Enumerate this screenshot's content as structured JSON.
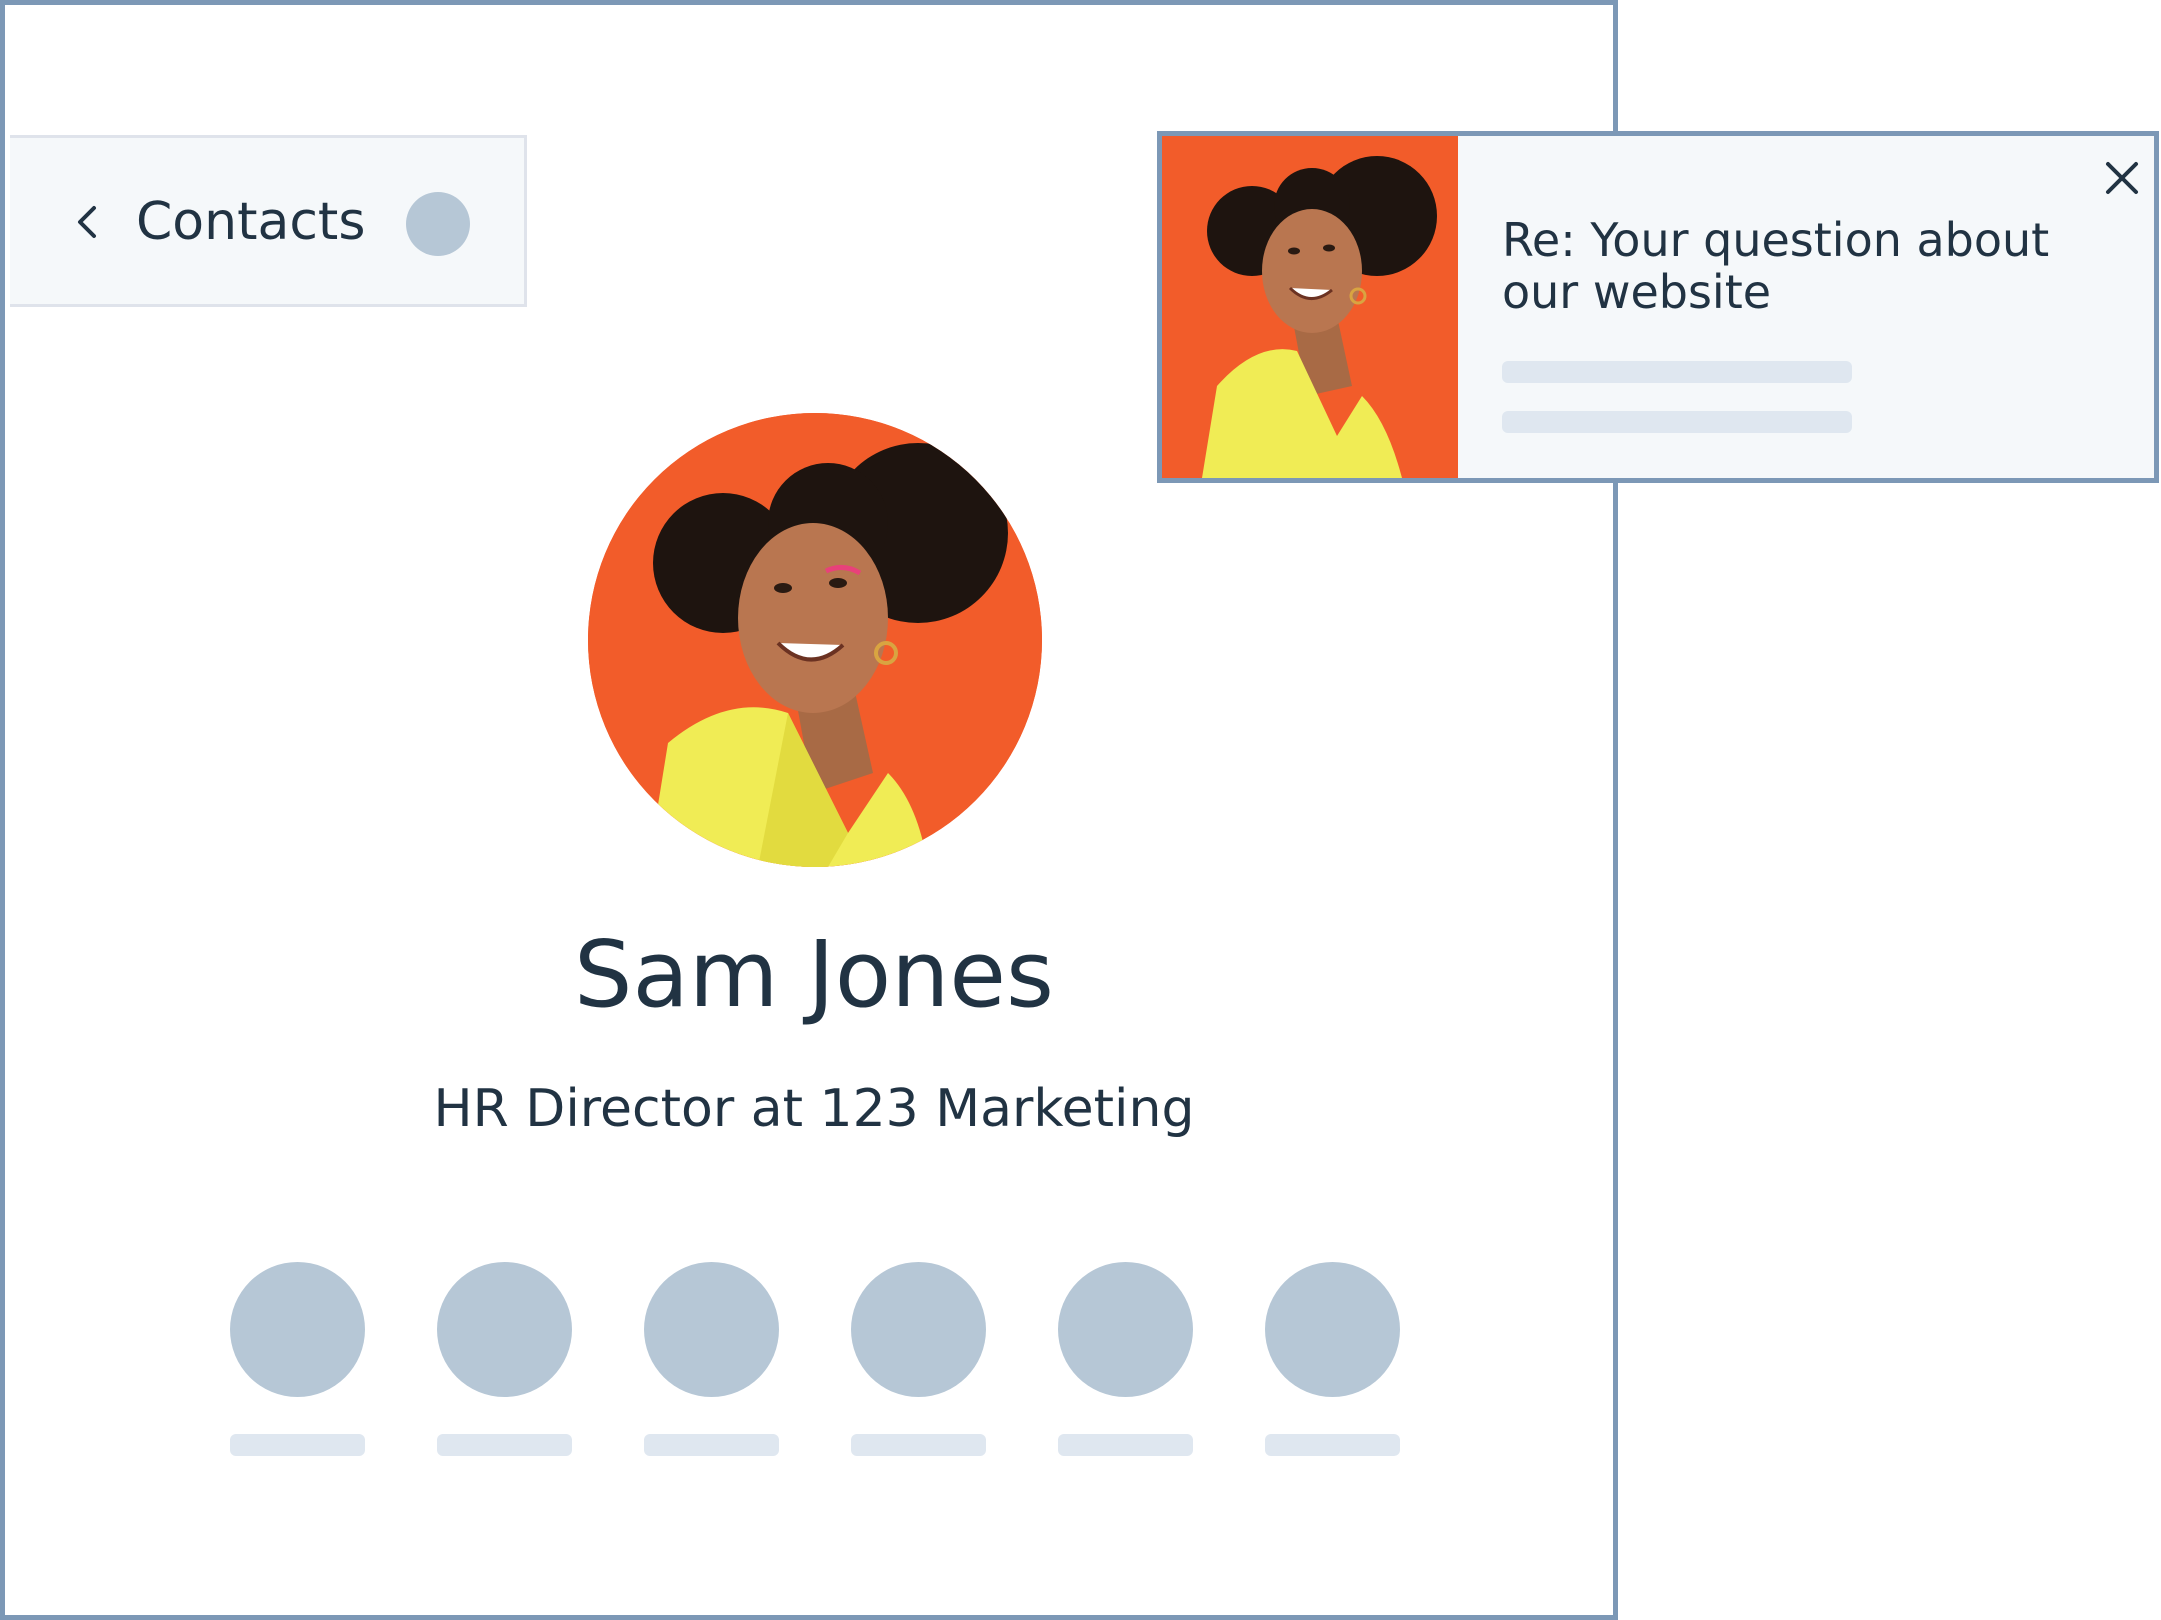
{
  "breadcrumb": {
    "label": "Contacts",
    "back_icon": "chevron-left-icon"
  },
  "contact": {
    "name": "Sam Jones",
    "subtitle": "HR Director at 123 Marketing",
    "avatar_icon": "contact-photo"
  },
  "actions": {
    "count": 6
  },
  "notification": {
    "title": "Re: Your question about our website",
    "close_icon": "close-icon"
  },
  "colors": {
    "border": "#7c98b6",
    "placeholder": "#b6c7d6",
    "placeholder_light": "#dfe7f0",
    "panel_bg": "#f5f8fa",
    "text": "#213343",
    "photo_bg": "#f25c2a",
    "jacket": "#f0ec55"
  }
}
